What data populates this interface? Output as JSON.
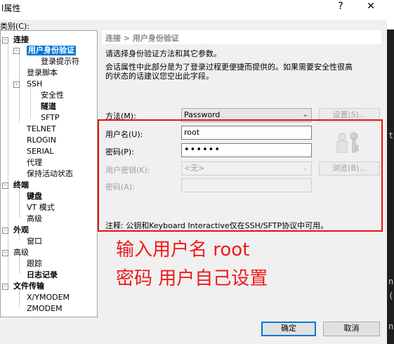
{
  "window": {
    "title": "l属性",
    "help_glyph": "?",
    "close_glyph": "✕"
  },
  "category_label": "类别(C):",
  "tree": [
    {
      "label": "连接",
      "bold": true,
      "toggle": "-"
    },
    {
      "label": "用户身份验证",
      "bold": true,
      "selected": true,
      "toggle": "-"
    },
    {
      "label": "登录提示符"
    },
    {
      "label": "登录脚本"
    },
    {
      "label": "SSH",
      "toggle": "-"
    },
    {
      "label": "安全性"
    },
    {
      "label": "隧道",
      "bold": true
    },
    {
      "label": "SFTP"
    },
    {
      "label": "TELNET"
    },
    {
      "label": "RLOGIN"
    },
    {
      "label": "SERIAL"
    },
    {
      "label": "代理"
    },
    {
      "label": "保持活动状态"
    },
    {
      "label": "终端",
      "bold": true,
      "toggle": "-"
    },
    {
      "label": "键盘",
      "bold": true
    },
    {
      "label": "VT 模式"
    },
    {
      "label": "高级"
    },
    {
      "label": "外观",
      "bold": true,
      "toggle": "-"
    },
    {
      "label": "窗口"
    },
    {
      "label": "高级",
      "toggle": "-"
    },
    {
      "label": "跟踪"
    },
    {
      "label": "日志记录",
      "bold": true
    },
    {
      "label": "文件传输",
      "bold": true,
      "toggle": "-"
    },
    {
      "label": "X/YMODEM"
    },
    {
      "label": "ZMODEM"
    }
  ],
  "panel": {
    "header": "连接 > 用户身份验证",
    "desc1": "请选择身份验证方法和其它参数。",
    "desc2a": "会话属性中此部分是为了登录过程更便捷而提供的。如果需要安全性很高",
    "desc2b": "的状态的话建议您空出此字段。",
    "method_label": "方法(M):",
    "method_value": "Password",
    "settings_button": "设置(S)...",
    "username_label": "用户名(U):",
    "username_value": "root",
    "password_label": "密码(P):",
    "password_value": "••••••",
    "userkey_label": "用户密钥(K):",
    "userkey_value": "<无>",
    "browse_button": "浏览(B)...",
    "passphrase_label": "密码(A):",
    "note": "注释: 公钥和Keyboard Interactive仅在SSH/SFTP协议中可用。"
  },
  "annotation": {
    "line1": "输入用户名 root",
    "line2": "密码  用户自己设置"
  },
  "buttons": {
    "ok": "确定",
    "cancel": "取消"
  },
  "right_strip": [
    "t",
    "ne",
    "(",
    "ne"
  ],
  "colors": {
    "accent": "#0078d7",
    "annotation_red": "#e81010"
  }
}
